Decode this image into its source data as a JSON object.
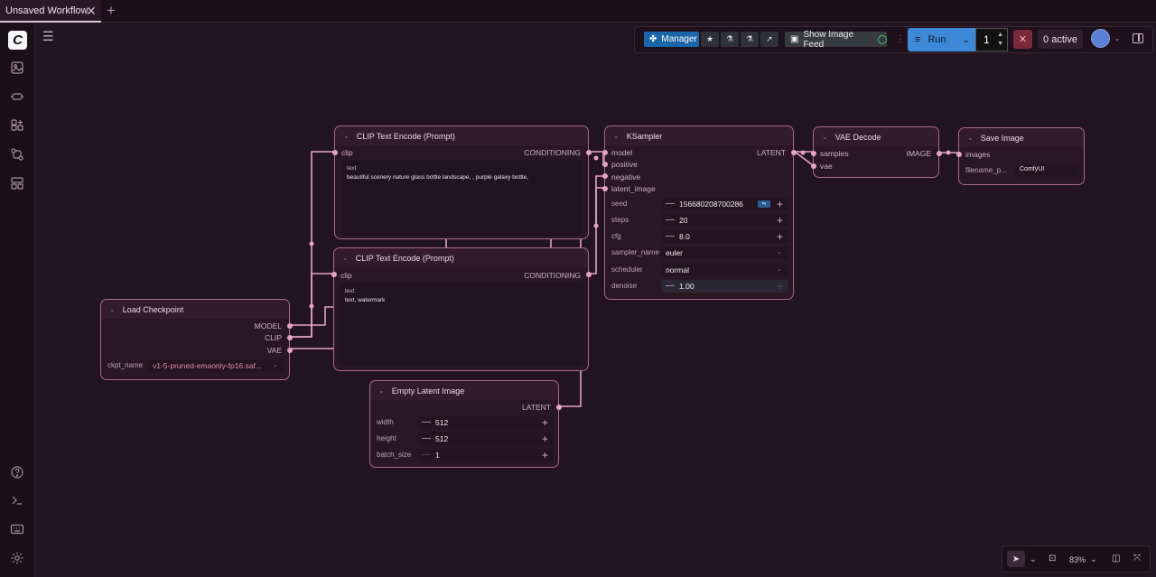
{
  "tabbar": {
    "workflow_tab": "Unsaved Workflow",
    "close_symbol": "✕",
    "new_tab_symbol": "+"
  },
  "sidebar": {
    "logo": "C",
    "icons": [
      "images-icon",
      "model-icon",
      "node-library-icon",
      "workflows-icon",
      "templates-icon",
      "help-icon",
      "terminal-icon",
      "keyboard-icon",
      "settings-icon"
    ]
  },
  "toolbar": {
    "manager_label": "Manager",
    "show_image_feed_label": "Show Image Feed",
    "run_label": "Run",
    "run_count": "1",
    "active_label": "0 active"
  },
  "nodes": {
    "clip1": {
      "title": "CLIP Text Encode (Prompt)",
      "input": "clip",
      "output": "CONDITIONING",
      "text_label": "text",
      "text_value": "beautiful scenery nature glass bottle landscape, , purple galaxy bottle,"
    },
    "clip2": {
      "title": "CLIP Text Encode (Prompt)",
      "input": "clip",
      "output": "CONDITIONING",
      "text_label": "text",
      "text_value": "text, watermark"
    },
    "ksampler": {
      "title": "KSampler",
      "inputs": [
        "model",
        "positive",
        "negative",
        "latent_image"
      ],
      "output": "LATENT",
      "widgets": {
        "seed_label": "seed",
        "seed": "156680208700286",
        "steps_label": "steps",
        "steps": "20",
        "cfg_label": "cfg",
        "cfg": "8.0",
        "sampler_label": "sampler_name",
        "sampler": "euler",
        "scheduler_label": "scheduler",
        "scheduler": "normal",
        "denoise_label": "denoise",
        "denoise": "1.00"
      }
    },
    "vae_decode": {
      "title": "VAE Decode",
      "inputs": [
        "samples",
        "vae"
      ],
      "output": "IMAGE"
    },
    "save_image": {
      "title": "Save Image",
      "input": "images",
      "filename_label": "filename_p...",
      "filename_value": "ComfyUI"
    },
    "load_checkpoint": {
      "title": "Load Checkpoint",
      "outputs": [
        "MODEL",
        "CLIP",
        "VAE"
      ],
      "ckpt_label": "ckpt_name",
      "ckpt_value": "v1-5-pruned-emaonly-fp16.saf..."
    },
    "empty_latent": {
      "title": "Empty Latent Image",
      "output": "LATENT",
      "width_label": "width",
      "width": "512",
      "height_label": "height",
      "height": "512",
      "batch_label": "batch_size",
      "batch": "1"
    }
  },
  "bottom_controls": {
    "zoom": "83%"
  },
  "colors": {
    "background": "#231520",
    "node_border": "#a86a8c",
    "link": "#e6a3c4",
    "run_button": "#3d89d8",
    "manager_button": "#1a65a8"
  }
}
